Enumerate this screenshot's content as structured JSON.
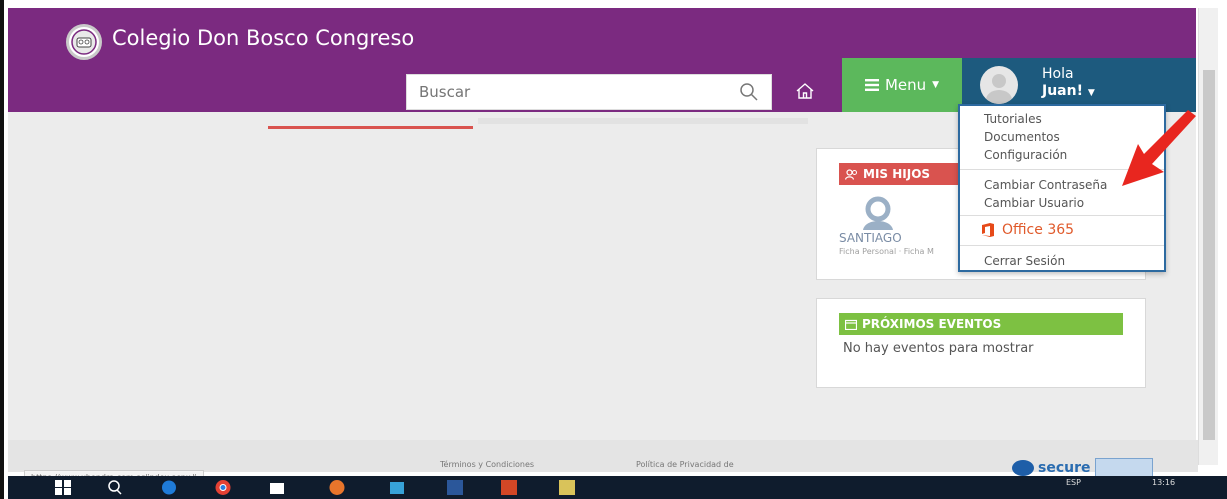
{
  "header": {
    "brand": "Colegio Don Bosco Congreso",
    "search_placeholder": "Buscar",
    "menu_label": "Menu",
    "user": {
      "greeting": "Hola",
      "name": "Juan!"
    }
  },
  "dropdown": {
    "items": [
      "Tutoriales",
      "Documentos",
      "Configuración",
      "Cambiar Contraseña",
      "Cambiar Usuario",
      "Cerrar Sesión"
    ],
    "office_label": "Office 365"
  },
  "hijos": {
    "title": "MIS HIJOS",
    "child_name": "SANTIAGO",
    "child_links": "Ficha Personal · Ficha M"
  },
  "eventos": {
    "title": "PRÓXIMOS EVENTOS",
    "empty": "No hay eventos para mostrar"
  },
  "footer": {
    "status_url": "https://www.xhendra.com.ar/index.aspx#",
    "terms": "Términos y Condiciones",
    "privacy": "Política de Privacidad de",
    "secure": "secure"
  },
  "taskbar": {
    "lang": "ESP",
    "time": "13:16"
  },
  "colors": {
    "header": "#7b2a80",
    "menu": "#5cb85c",
    "user": "#1d5a7e",
    "hijos": "#d9534f",
    "eventos": "#7dc142"
  }
}
